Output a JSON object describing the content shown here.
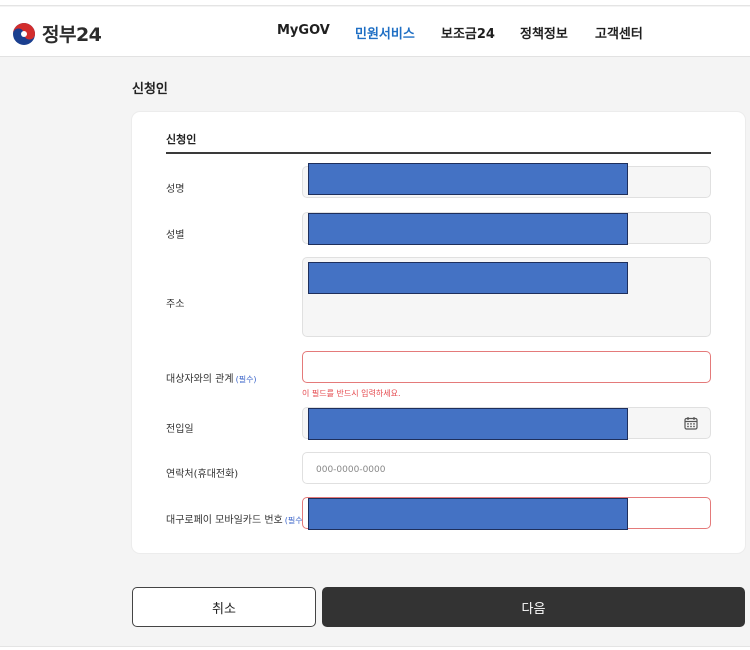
{
  "header": {
    "logo_text": "정부24",
    "nav": [
      {
        "label": "MyGOV",
        "active": false
      },
      {
        "label": "민원서비스",
        "active": true
      },
      {
        "label": "보조금24",
        "active": false
      },
      {
        "label": "정책정보",
        "active": false
      },
      {
        "label": "고객센터",
        "active": false
      }
    ]
  },
  "section": {
    "title": "신청인"
  },
  "card": {
    "title": "신청인",
    "fields": {
      "name": {
        "label": "성명"
      },
      "gender": {
        "label": "성별"
      },
      "address": {
        "label": "주소"
      },
      "relation": {
        "label": "대상자와의 관계",
        "required": "(필수)",
        "error": "이 필드를 반드시 입력하세요."
      },
      "move_in_date": {
        "label": "전입일"
      },
      "phone": {
        "label": "연락처(휴대전화)",
        "placeholder": "000-0000-0000"
      },
      "card_number": {
        "label": "대구로페이 모바일카드 번호",
        "required": "(필수)"
      }
    }
  },
  "buttons": {
    "cancel": "취소",
    "next": "다음"
  },
  "colors": {
    "accent": "#1f6fc4",
    "error": "#e5484d",
    "redaction": "#4472c4",
    "primary_button": "#333333"
  }
}
